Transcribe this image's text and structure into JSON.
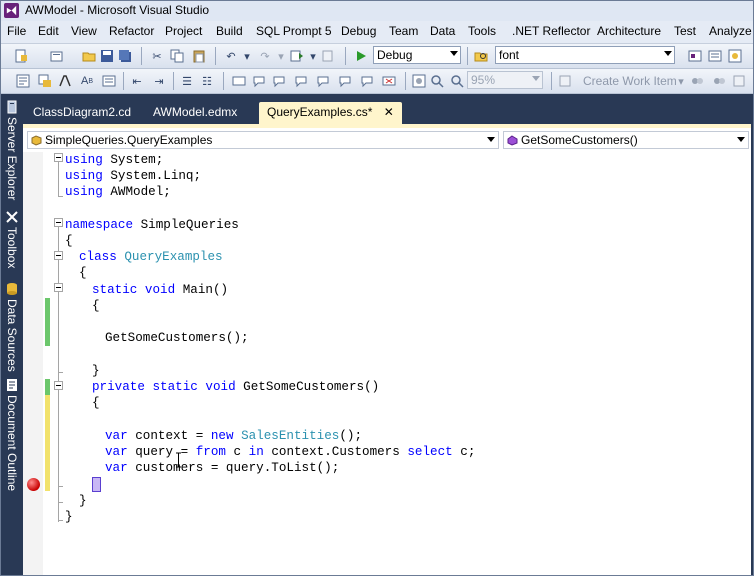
{
  "window": {
    "title": "AWModel - Microsoft Visual Studio"
  },
  "menu": [
    "File",
    "Edit",
    "View",
    "Refactor",
    "Project",
    "Build",
    "SQL Prompt 5",
    "Debug",
    "Team",
    "Data",
    "Tools",
    ".NET Reflector",
    "Architecture",
    "Test",
    "Analyze"
  ],
  "toolbar": {
    "configuration": "Debug",
    "find_text": "font",
    "zoom": "95%",
    "create_work_item": "Create Work Item"
  },
  "side_tabs": [
    "Server Explorer",
    "Toolbox",
    "Data Sources",
    "Document Outline"
  ],
  "doc_tabs": [
    {
      "label": "ClassDiagram2.cd",
      "active": false
    },
    {
      "label": "AWModel.edmx",
      "active": false
    },
    {
      "label": "QueryExamples.cs*",
      "active": true
    }
  ],
  "doc_tab_close": "✕",
  "navbar": {
    "type_selector": "SimpleQueries.QueryExamples",
    "member_selector": "GetSomeCustomers()"
  },
  "code": {
    "l1": {
      "kw": "using",
      "rest": " System;"
    },
    "l2": {
      "kw": "using",
      "rest": " System.Linq;"
    },
    "l3": {
      "kw": "using",
      "rest": " AWModel;"
    },
    "l5": {
      "kw": "namespace",
      "rest": " SimpleQueries"
    },
    "l6": "{",
    "l7": {
      "kw": "class",
      "type": "QueryExamples"
    },
    "l8": "{",
    "l9": {
      "kw1": "static",
      "kw2": "void",
      "rest": " Main()"
    },
    "l10": "{",
    "l12": "GetSomeCustomers();",
    "l14": "}",
    "l15": {
      "kw1": "private",
      "kw2": "static",
      "kw3": "void",
      "rest": " GetSomeCustomers()"
    },
    "l16": "{",
    "l18": {
      "kw": "var",
      "mid": " context = ",
      "kw2": "new",
      "type": "SalesEntities",
      "rest": "();"
    },
    "l19": {
      "kw": "var",
      "mid": " query = ",
      "kw2": "from",
      "mid2": " c ",
      "kw3": "in",
      "mid3": " context.Customers ",
      "kw4": "select",
      "rest": " c;"
    },
    "l20": {
      "kw": "var",
      "rest": " customers = query.ToList();"
    },
    "l22": "}",
    "l23": "}"
  }
}
